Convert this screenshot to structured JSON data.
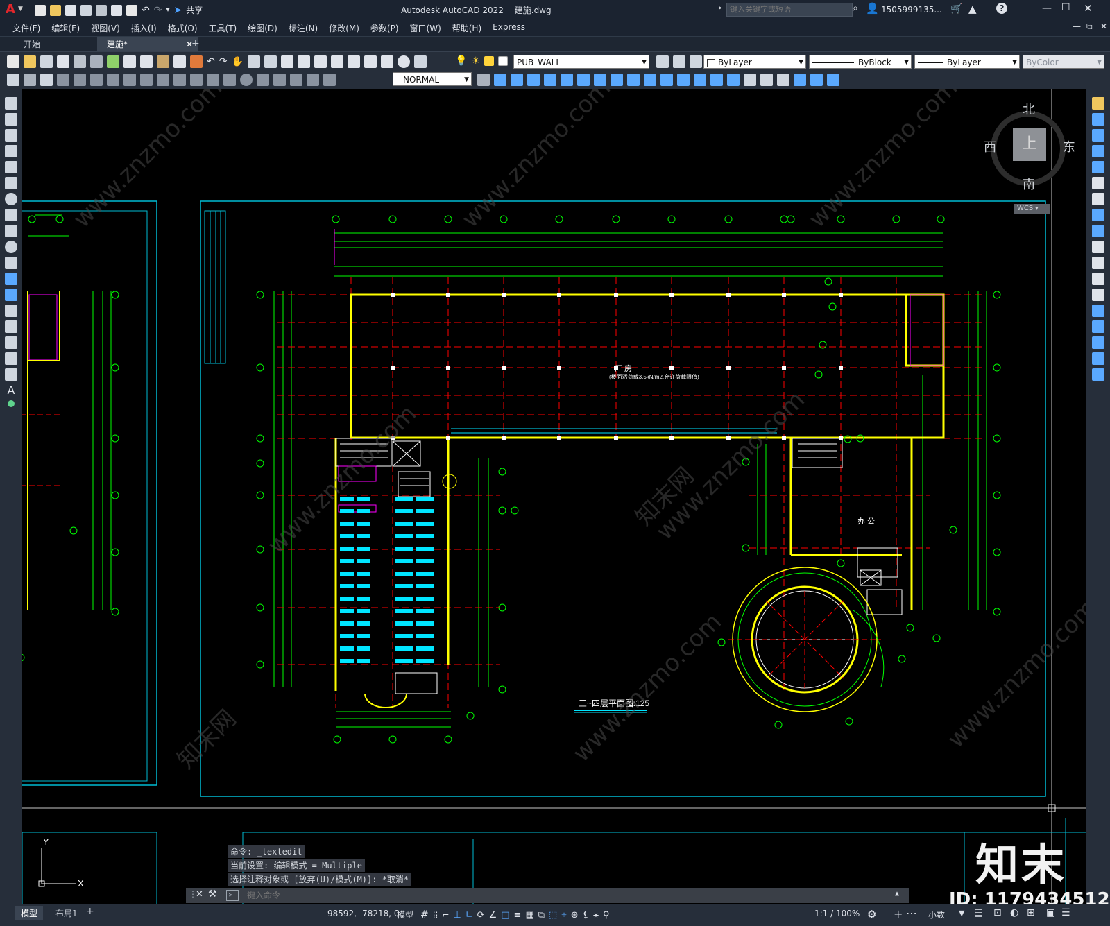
{
  "app": {
    "title": "Autodesk AutoCAD 2022",
    "file": "建施.dwg",
    "share_label": "共享",
    "search_placeholder": "键入关键字或短语",
    "user": "1505999135...",
    "logo_letter": "A"
  },
  "menu": [
    "文件(F)",
    "编辑(E)",
    "视图(V)",
    "插入(I)",
    "格式(O)",
    "工具(T)",
    "绘图(D)",
    "标注(N)",
    "修改(M)",
    "参数(P)",
    "窗口(W)",
    "帮助(H)",
    "Express"
  ],
  "tabs": [
    {
      "label": "开始",
      "active": false
    },
    {
      "label": "建施*",
      "active": true
    }
  ],
  "properties": {
    "layer": "PUB_WALL",
    "color": "ByLayer",
    "linetype": "ByBlock",
    "lineweight": "ByLayer",
    "plotstyle": "ByColor",
    "textstyle": "NORMAL"
  },
  "viewcube": {
    "north": "北",
    "south": "南",
    "east": "东",
    "west": "西",
    "face": "上",
    "wcs": "WCS"
  },
  "drawing": {
    "title": "三~四层平面图",
    "scale": "1:125",
    "room_factory": "厂 房",
    "room_factory_note": "(楼面活荷载3.5kN/m2,允许荷载限值)",
    "room_office": "办 公"
  },
  "command": {
    "history": [
      "命令: _textedit",
      "当前设置: 编辑模式 = Multiple",
      "选择注释对象或 [放弃(U)/模式(M)]: *取消*"
    ],
    "placeholder": "键入命令"
  },
  "layout_tabs": [
    "模型",
    "布局1"
  ],
  "status": {
    "coords": "98592, -78218, 0",
    "model": "模型",
    "scale": "1:1 / 100%",
    "units": "小数"
  },
  "watermark": {
    "brand": "知末",
    "id": "ID: 1179434512",
    "url": "www.znzmo.com",
    "cn": "知末网"
  },
  "colors": {
    "canvas": "#000000",
    "ui_dark": "#1b2330",
    "ui_panel": "#262e3a",
    "wall": "#ffff00",
    "axis": "#ff0000",
    "dim": "#00ff00",
    "frame": "#00bcd4",
    "furniture": "#00e5ff",
    "magenta": "#ff00ff",
    "accent": "#3b82f6"
  }
}
